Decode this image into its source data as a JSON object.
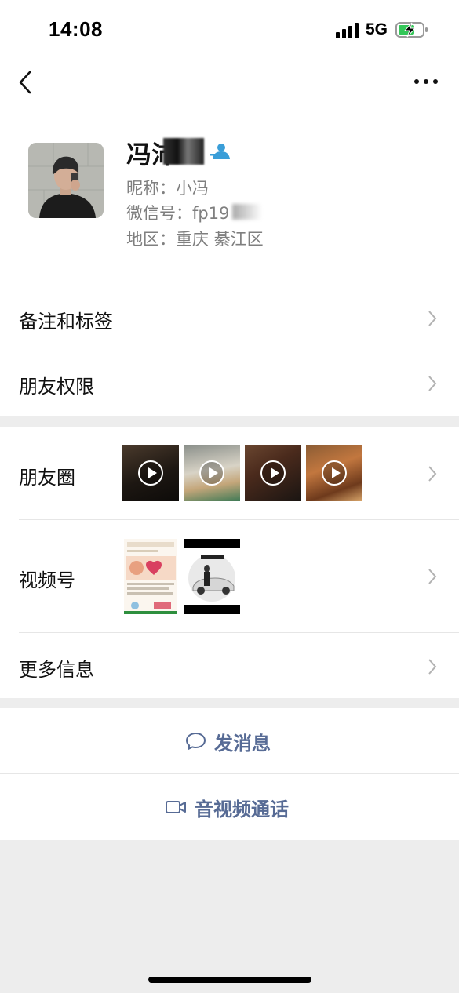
{
  "status_bar": {
    "time": "14:08",
    "network": "5G"
  },
  "profile": {
    "name": "冯沛",
    "nickname_label": "昵称：",
    "nickname": "小冯",
    "wechat_id_label": "微信号：",
    "wechat_id": "fp19",
    "region_label": "地区：",
    "region": "重庆 綦江区"
  },
  "menu": {
    "remarks_tags": "备注和标签",
    "friend_permissions": "朋友权限",
    "moments": "朋友圈",
    "channels": "视频号",
    "more_info": "更多信息"
  },
  "actions": {
    "send_message": "发消息",
    "video_call": "音视频通话"
  },
  "colors": {
    "link": "#576b95",
    "background": "#ededed",
    "verify": "#3a9ed8"
  }
}
